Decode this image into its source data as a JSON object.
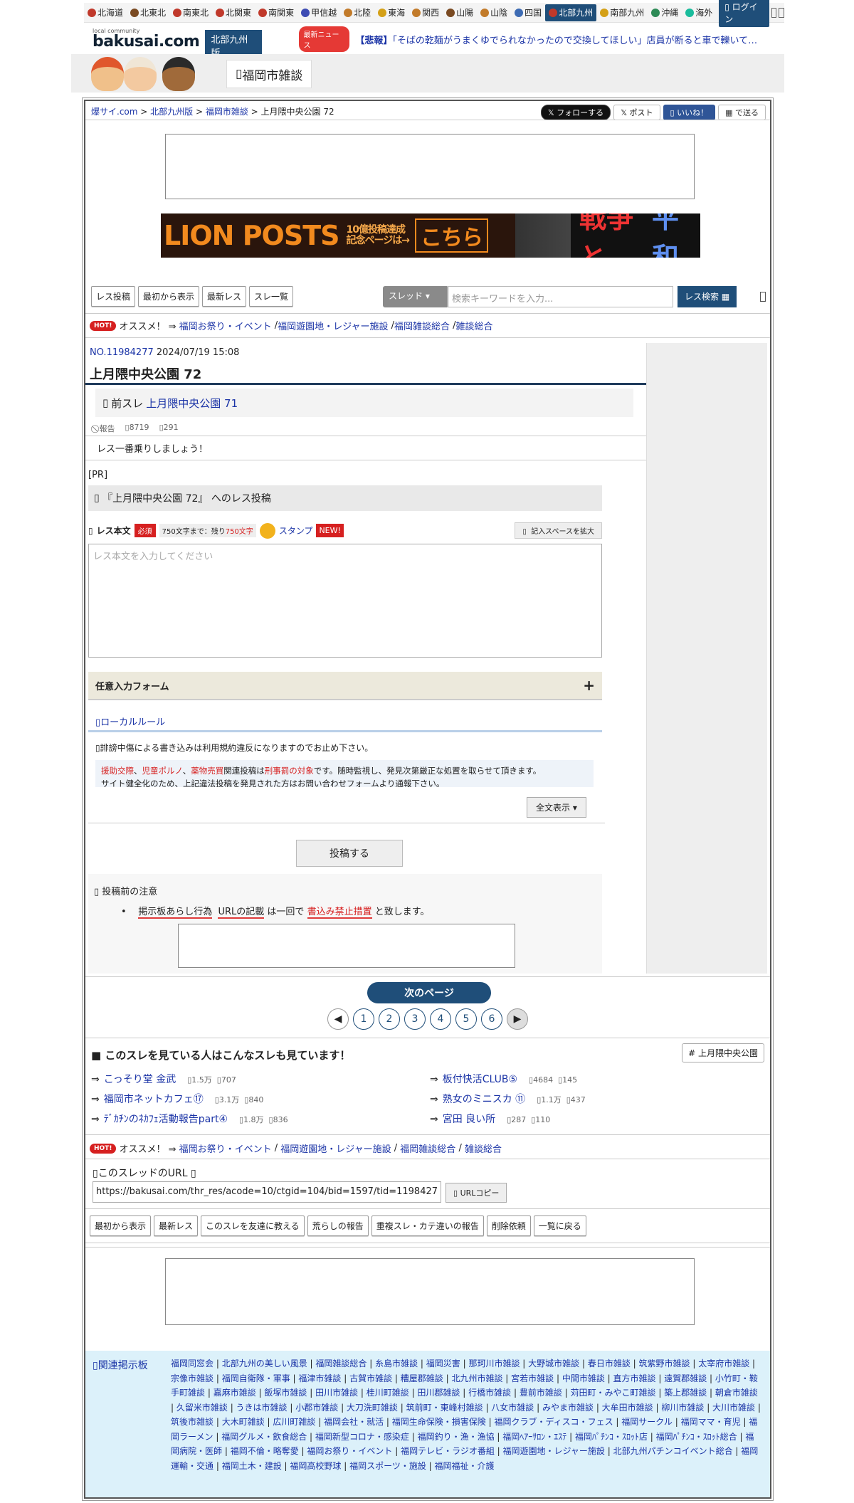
{
  "regions": [
    {
      "label": "北海道",
      "color": "#c0392b"
    },
    {
      "label": "北東北",
      "color": "#7a4a22"
    },
    {
      "label": "南東北",
      "color": "#c0392b"
    },
    {
      "label": "北関東",
      "color": "#c0392b"
    },
    {
      "label": "南関東",
      "color": "#c0392b"
    },
    {
      "label": "甲信越",
      "color": "#3d4bb3"
    },
    {
      "label": "北陸",
      "color": "#c27b2a"
    },
    {
      "label": "東海",
      "color": "#d4a017"
    },
    {
      "label": "関西",
      "color": "#c27b2a"
    },
    {
      "label": "山陽",
      "color": "#7a4a22"
    },
    {
      "label": "山陰",
      "color": "#c27b2a"
    },
    {
      "label": "四国",
      "color": "#3d6bb3"
    },
    {
      "label": "北部九州",
      "color": "#c0392b"
    },
    {
      "label": "南部九州",
      "color": "#d4a017"
    },
    {
      "label": "沖縄",
      "color": "#2e8b57"
    },
    {
      "label": "海外",
      "color": "#1abc9c"
    }
  ],
  "login": "ログイン",
  "logo": {
    "small": "local community",
    "main": "bakusai.com",
    "edition": "北部九州版"
  },
  "news": {
    "badge": "最新ニュース",
    "tag": "【悲報】",
    "text": "「そばの乾麺がうまくゆでられなかったので交換してほしい」店員が断ると車で轢いて…"
  },
  "board_tab": "福岡市雑談",
  "breadcrumb": {
    "home": "爆サイ.com",
    "edition": "北部九州版",
    "board": "福岡市雑談",
    "current": "上月隈中央公園 72"
  },
  "social": {
    "follow": "フォローする",
    "post": "ポスト",
    "like": "いいね！",
    "send": "で送る"
  },
  "banner": {
    "main": "LION POSTS",
    "sub1": "10億投稿達成",
    "sub2": "記念ページは→",
    "cta": "こちら",
    "right1": "戦争と",
    "right2": "平和"
  },
  "toolbar": {
    "res_post": "レス投稿",
    "from_start": "最初から表示",
    "latest": "最新レス",
    "thread_list": "スレ一覧"
  },
  "search": {
    "select": "スレッド",
    "placeholder": "検索キーワードを入力...",
    "button": "レス検索"
  },
  "hot": {
    "badge": "HOT!",
    "label": "オススメ！ ⇒",
    "links": [
      "福岡お祭り・イベント",
      "福岡遊園地・レジャー施設",
      "福岡雑談総合",
      "雑談総合"
    ]
  },
  "post": {
    "no": "NO.11984277",
    "date": "2024/07/19 15:08",
    "title": "上月隈中央公園 72",
    "prev_label": "前スレ",
    "prev_link": "上月隈中央公園 71",
    "report": "報告",
    "views": "8719",
    "count": "291",
    "message": "レス一番乗りしましょう！"
  },
  "pr": "[PR]",
  "form": {
    "heading": "『上月隈中央公園 72』 へのレス投稿",
    "body_label": "レス本文",
    "required": "必須",
    "count_prefix": "750文字まで：残り",
    "count_value": "750文字",
    "stamp": "スタンプ",
    "new": "NEW!",
    "expand": "記入スペースを拡大",
    "placeholder": "レス本文を入力してください",
    "optional": "任意入力フォーム",
    "local_rule": "ローカルルール",
    "warning": "誹謗中傷による書き込みは利用規約違反になりますのでお止め下さい。",
    "rule_red1": "援助交際",
    "rule_red2": "児童ポルノ",
    "rule_red3": "薬物売買",
    "rule_mid": "関連投稿は",
    "rule_red4": "刑事罰の対象",
    "rule_tail": "です。随時監視し、発見次第厳正な処置を取らせて頂きます。",
    "rule_line2": "サイト健全化のため、上記違法投稿を発見された方はお問い合わせフォームより通報下さい。",
    "full_view": "全文表示 ▾",
    "submit": "投稿する",
    "notice_title": "投稿前の注意",
    "notice_a": "掲示板あらし行為",
    "notice_b": "URLの記載",
    "notice_mid": "は一回で",
    "notice_c": "書込み禁止措置",
    "notice_tail": "と致します。"
  },
  "pagination": {
    "next": "次のページ",
    "pages": [
      "1",
      "2",
      "3",
      "4",
      "5",
      "6"
    ]
  },
  "related": {
    "title": "■ このスレを見ている人はこんなスレも見ています！",
    "tag": "# 上月隈中央公園",
    "items": [
      {
        "title": "こっそり堂 金武",
        "views": "1.5万",
        "count": "707"
      },
      {
        "title": "板付快活CLUB⑤",
        "views": "4684",
        "count": "145"
      },
      {
        "title": "福岡市ネットカフェ⑰",
        "views": "3.1万",
        "count": "840"
      },
      {
        "title": "熟女のミニスカ ⑪",
        "views": "1.1万",
        "count": "437"
      },
      {
        "title": "ﾃﾞｶﾁﾝのﾈｶﾌｪ活動報告part④",
        "views": "1.8万",
        "count": "836"
      },
      {
        "title": "宮田 良い所",
        "views": "287",
        "count": "110"
      }
    ]
  },
  "url_section": {
    "label": "このスレッドのURL",
    "url": "https://bakusai.com/thr_res/acode=10/ctgid=104/bid=1597/tid=1198427",
    "copy": "URLコピー"
  },
  "bottom_buttons": [
    "最初から表示",
    "最新レス",
    "このスレを友達に教える",
    "荒らしの報告",
    "重複スレ・カテ違いの報告",
    "削除依頼",
    "一覧に戻る"
  ],
  "footer": {
    "label": "関連掲示板",
    "links": [
      "福岡同窓会",
      "北部九州の美しい風景",
      "福岡雑談総合",
      "糸島市雑談",
      "福岡災害",
      "那珂川市雑談",
      "大野城市雑談",
      "春日市雑談",
      "筑紫野市雑談",
      "太宰府市雑談",
      "宗像市雑談",
      "福岡自衛隊・軍事",
      "福津市雑談",
      "古賀市雑談",
      "糟屋郡雑談",
      "北九州市雑談",
      "宮若市雑談",
      "中間市雑談",
      "直方市雑談",
      "遠賀郡雑談",
      "小竹町・鞍手町雑談",
      "嘉麻市雑談",
      "飯塚市雑談",
      "田川市雑談",
      "桂川町雑談",
      "田川郡雑談",
      "行橋市雑談",
      "豊前市雑談",
      "苅田町・みやこ町雑談",
      "築上郡雑談",
      "朝倉市雑談",
      "久留米市雑談",
      "うきは市雑談",
      "小郡市雑談",
      "大刀洗町雑談",
      "筑前町・東峰村雑談",
      "八女市雑談",
      "みやま市雑談",
      "大牟田市雑談",
      "柳川市雑談",
      "大川市雑談",
      "筑後市雑談",
      "大木町雑談",
      "広川町雑談",
      "福岡会社・就活",
      "福岡生命保険・損害保険",
      "福岡クラブ・ディスコ・フェス",
      "福岡サークル",
      "福岡ママ・育児",
      "福岡ラーメン",
      "福岡グルメ・飲食総合",
      "福岡新型コロナ・感染症",
      "福岡釣り・漁・漁協",
      "福岡ﾍｱｰｻﾛﾝ・ｴｽﾃ",
      "福岡ﾊﾟﾁﾝｺ・ｽﾛｯﾄ店",
      "福岡ﾊﾟﾁﾝｺ・ｽﾛｯﾄ総合",
      "福岡病院・医師",
      "福岡不倫・略奪愛",
      "福岡お祭り・イベント",
      "福岡テレビ・ラジオ番組",
      "福岡遊園地・レジャー施設",
      "北部九州パチンコイベント総合",
      "福岡運輸・交通",
      "福岡土木・建設",
      "福岡高校野球",
      "福岡スポーツ・施設",
      "福岡福祉・介護"
    ]
  }
}
